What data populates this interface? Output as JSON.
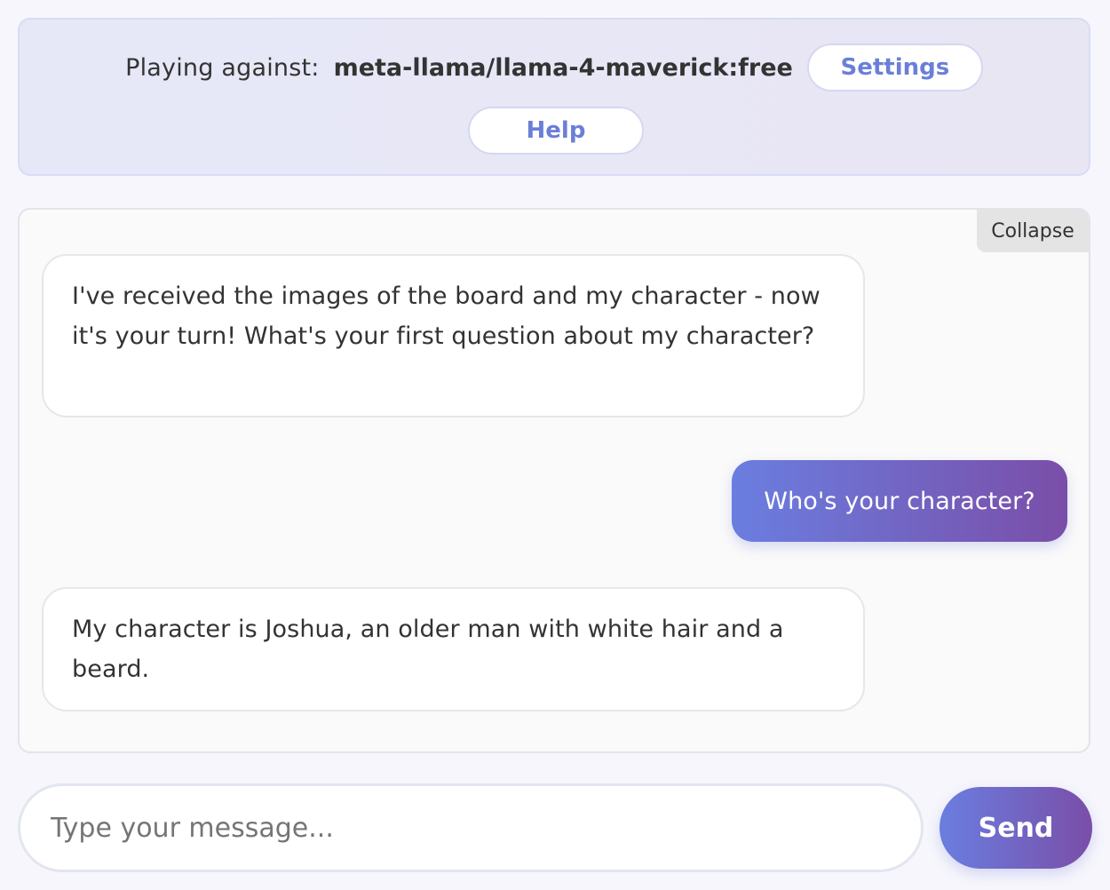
{
  "header": {
    "playing_label": "Playing against:",
    "model_name": "meta-llama/llama-4-maverick:free",
    "settings_label": "Settings",
    "help_label": "Help"
  },
  "chat": {
    "collapse_label": "Collapse",
    "messages": [
      {
        "role": "assistant",
        "text": "I've received the images of the board and my character - now it's your turn! What's your first question about my character?"
      },
      {
        "role": "user",
        "text": "Who's your character?"
      },
      {
        "role": "assistant",
        "text": "My character is Joshua, an older man with white hair and a beard."
      }
    ]
  },
  "composer": {
    "placeholder": "Type your message...",
    "value": "",
    "send_label": "Send"
  },
  "colors": {
    "accent": "#6b7fd8",
    "gradient_start": "#6a7ee0",
    "gradient_end": "#7a4ea8"
  }
}
